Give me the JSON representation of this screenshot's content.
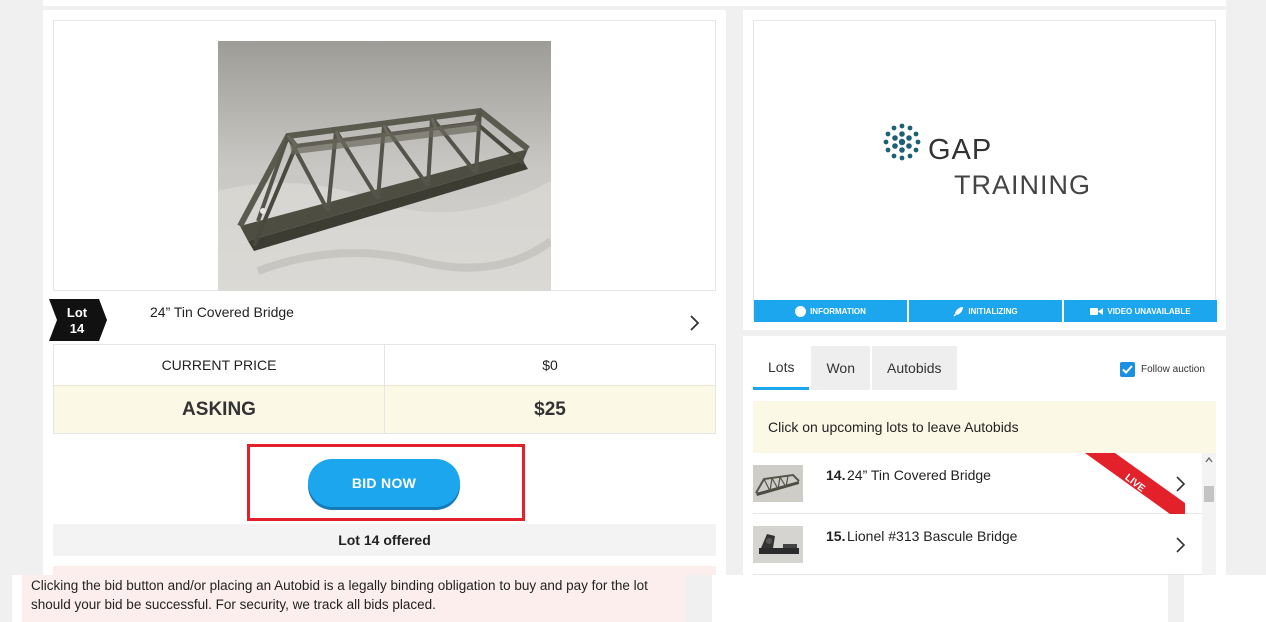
{
  "lot": {
    "badge_label": "Lot",
    "badge_number": "14",
    "title": "24” Tin Covered Bridge"
  },
  "price": {
    "current_label": "CURRENT PRICE",
    "current_value": "$0",
    "asking_label": "ASKING",
    "asking_value": "$25"
  },
  "bid_button_label": "BID NOW",
  "offered_text": "Lot 14 offered",
  "disclaimer": "Clicking the bid button and/or placing an Autobid is a legally binding obligation to buy and pay for the lot should your bid be successful. For security, we track all bids placed.",
  "video": {
    "brand_line1": "GAP",
    "brand_line2": "TRAINING",
    "status": [
      {
        "label": "INFORMATION",
        "icon": "info-icon"
      },
      {
        "label": "INITIALIZING",
        "icon": "rocket-icon"
      },
      {
        "label": "VIDEO UNAVAILABLE",
        "icon": "video-camera-icon"
      }
    ]
  },
  "tabs": [
    "Lots",
    "Won",
    "Autobids"
  ],
  "follow_label": "Follow auction",
  "follow_checked": true,
  "autobid_note": "Click on upcoming lots to leave Autobids",
  "lot_list": [
    {
      "number": "14.",
      "name": "24” Tin Covered Bridge",
      "badge": "LIVE"
    },
    {
      "number": "15.",
      "name": "Lionel #313 Bascule Bridge"
    }
  ],
  "colors": {
    "accent": "#1ba6ee",
    "highlight_border": "#e3212a",
    "live_ribbon": "#e3212a",
    "asking_bg": "#fcf8e6",
    "disclaimer_bg": "#fdeeee"
  }
}
